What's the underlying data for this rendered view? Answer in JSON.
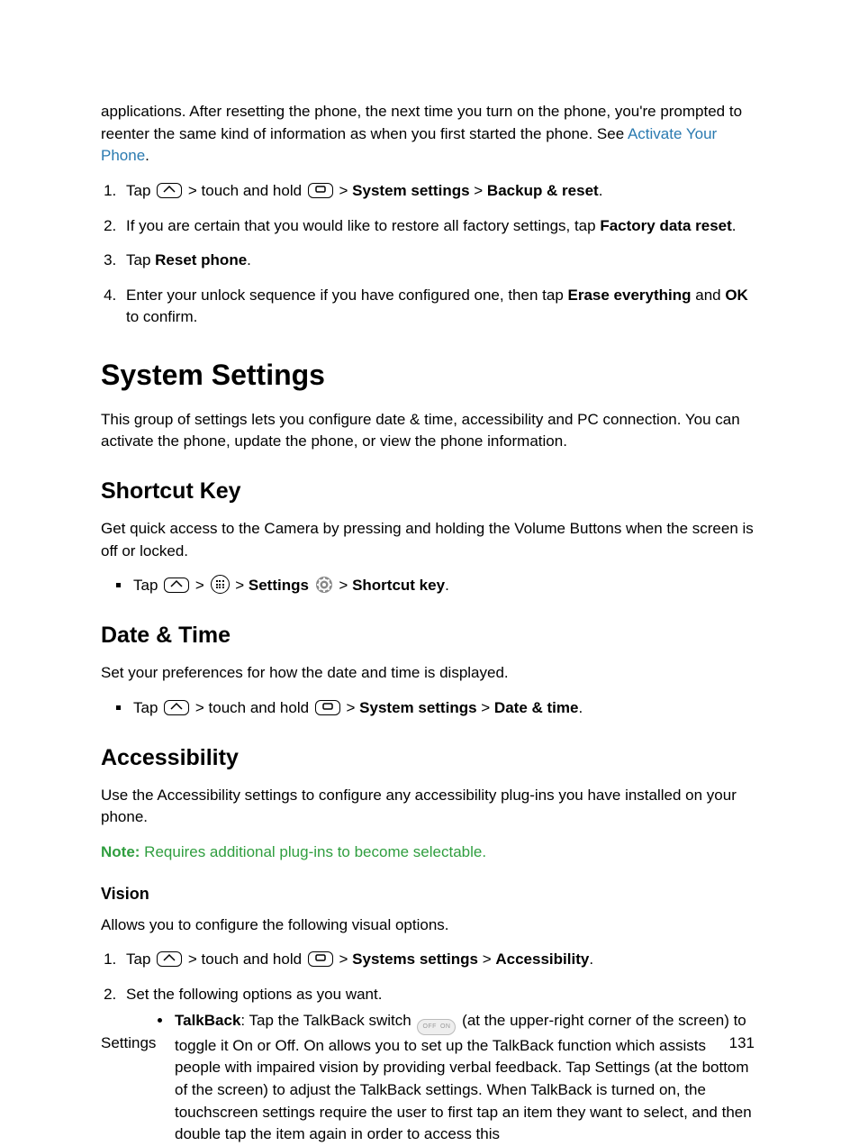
{
  "intro_para": "applications. After resetting the phone, the next time you turn on the phone, you're prompted to reenter the same kind of information as when you first started the phone. See ",
  "intro_link": "Activate Your Phone",
  "intro_tail": ".",
  "steps_a": {
    "s1_pre": "Tap ",
    "s1_mid1": " > touch and hold ",
    "s1_mid2": " > ",
    "s1_b1": "System settings",
    "s1_mid3": " > ",
    "s1_b2": "Backup & reset",
    "s1_tail": ".",
    "s2_pre": "If you are certain that you would like to restore all factory settings, tap ",
    "s2_b": "Factory data reset",
    "s2_tail": ".",
    "s3_pre": "Tap ",
    "s3_b": "Reset phone",
    "s3_tail": ".",
    "s4_pre": "Enter your unlock sequence if you have configured one, then tap ",
    "s4_b1": "Erase everything",
    "s4_mid": " and ",
    "s4_b2": "OK",
    "s4_tail": " to confirm."
  },
  "h_system": "System Settings",
  "p_system": "This group of settings lets you configure date & time, accessibility and PC connection. You can activate the phone, update the phone, or view the phone information.",
  "h_shortcut": "Shortcut Key",
  "p_shortcut": "Get quick access to the Camera by pressing and holding the Volume Buttons when the screen is off or locked.",
  "bul_shortcut": {
    "pre": "Tap ",
    "sep": " > ",
    "b1": "Settings",
    "b2": "Shortcut key",
    "tail": "."
  },
  "h_date": "Date & Time",
  "p_date": "Set your preferences for how the date and time is displayed.",
  "bul_date": {
    "pre": "Tap ",
    "mid1": " > touch and hold ",
    "sep": " > ",
    "b1": "System settings",
    "b2": "Date & time",
    "tail": "."
  },
  "h_access": "Accessibility",
  "p_access": "Use the Accessibility settings to configure any accessibility plug-ins you have installed on your phone.",
  "note_label": "Note:",
  "note_text": " Requires additional plug-ins to become selectable.",
  "h_vision": "Vision",
  "p_vision": "Allows you to configure the following visual options.",
  "steps_b": {
    "s1_pre": "Tap ",
    "s1_mid1": " > touch and hold ",
    "s1_sep": " > ",
    "s1_b1": "Systems settings",
    "s1_b2": "Accessibility",
    "s1_tail": ".",
    "s2": "Set the following options as you want.",
    "talk_b": "TalkBack",
    "talk_pre": ": Tap the TalkBack switch ",
    "talk_post": " (at the upper-right corner of the screen) to toggle it On or Off. On allows you to set up the TalkBack function which assists people with impaired vision by providing verbal feedback. Tap Settings (at the bottom of the screen) to adjust the TalkBack settings. When TalkBack is turned on, the touchscreen settings require the user to first tap an item they want to select, and then double tap the item again in order to access this"
  },
  "switch_off": "OFF",
  "switch_on": "ON",
  "footer_left": "Settings",
  "footer_right": "131"
}
